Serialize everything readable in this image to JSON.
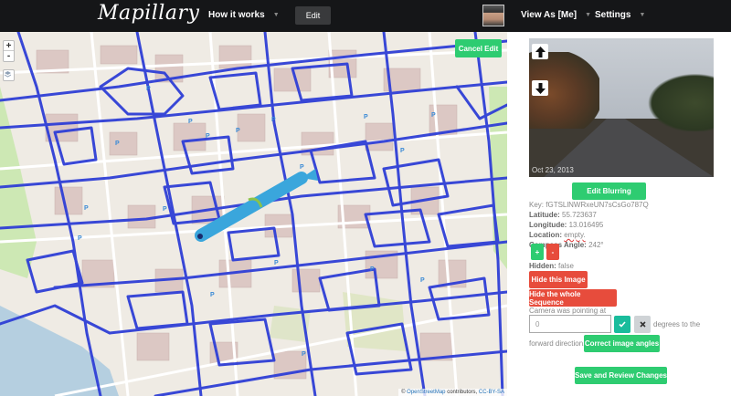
{
  "nav": {
    "logo": "Mapillary",
    "how_it_works": "How it works",
    "edit": "Edit",
    "view_as": "View As [Me]",
    "settings": "Settings"
  },
  "map": {
    "zoom_in": "+",
    "zoom_out": "-",
    "cancel_edit": "Cancel Edit",
    "attribution_prefix": "©",
    "attribution_osm": "OpenStreetMap",
    "attribution_mid": "contributors,",
    "attribution_license": "CC-BY-SA",
    "coverage_color": "#2f3fd6",
    "sequence_color": "#3aa6dc"
  },
  "photo": {
    "date": "Oct 23, 2013",
    "up_icon": "arrow-up-icon",
    "down_icon": "arrow-down-icon"
  },
  "panel": {
    "edit_blurring": "Edit Blurring",
    "key_label": "Key:",
    "key_value": "fGTSLlNWRxeUN7sCsGo787Q",
    "latitude_label": "Latitude:",
    "latitude_value": "55.723637",
    "longitude_label": "Longitude:",
    "longitude_value": "13.016495",
    "location_label": "Location:",
    "location_value": "empty.",
    "compass_label": "Compass Angle:",
    "compass_value": "242°",
    "plus": "+",
    "minus": "-",
    "hidden_label": "Hidden:",
    "hidden_value": "false",
    "hide_image": "Hide this Image",
    "hide_sequence": "Hide the whole Sequence",
    "camera_text": "Camera was pointing at",
    "angle_value": "0",
    "check_icon": "check-icon",
    "close_icon": "close-icon",
    "degrees_text": "degrees to the",
    "forward_text": "forward direction.",
    "correct_angles": "Correct image angles",
    "save_review": "Save and Review Changes"
  }
}
